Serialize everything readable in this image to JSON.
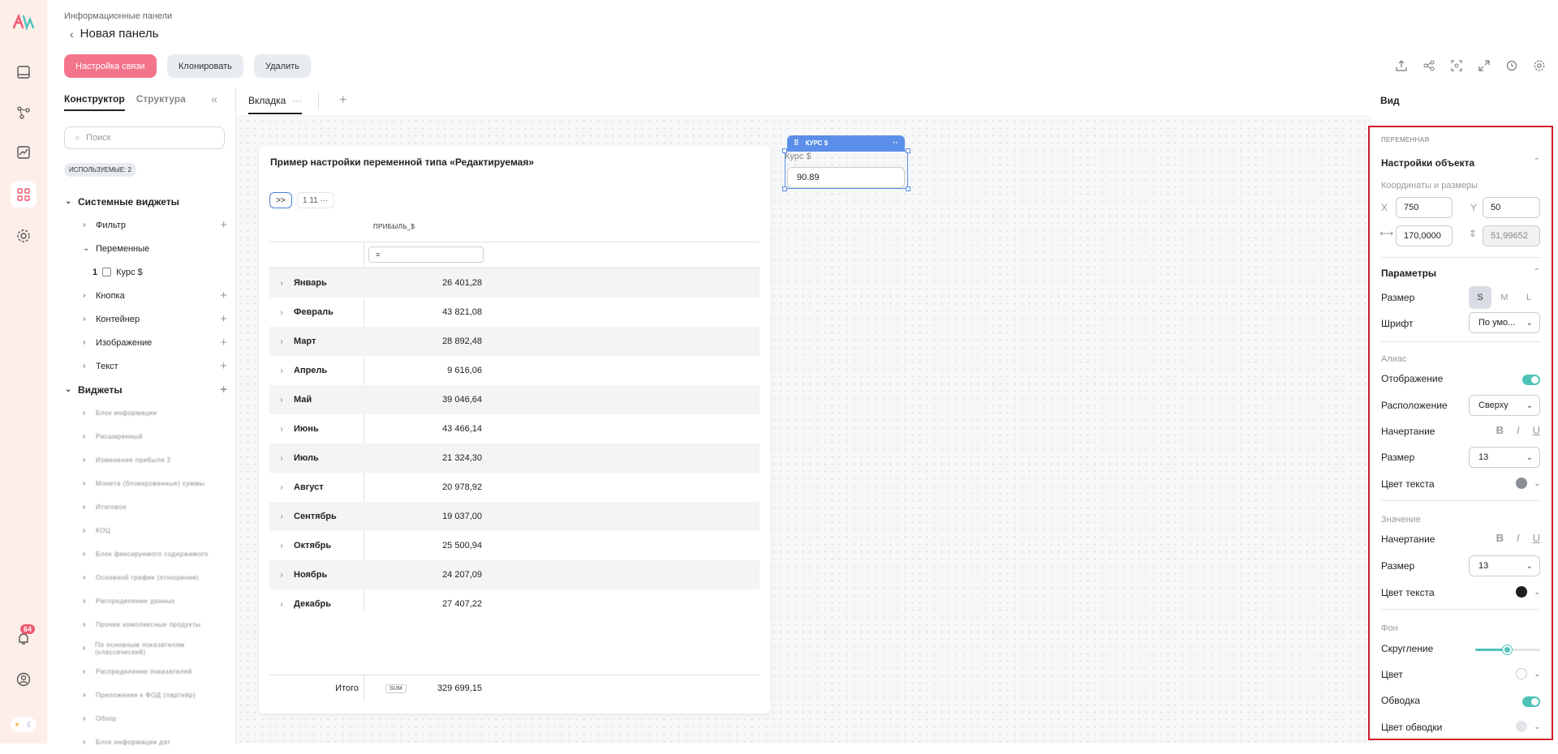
{
  "header": {
    "breadcrumb": "Информационные панели",
    "title": "Новая панель",
    "buttons": {
      "link_settings": "Настройка связи",
      "clone": "Клонировать",
      "delete": "Удалить"
    }
  },
  "sidebar": {
    "tab_constructor": "Конструктор",
    "tab_structure": "Структура",
    "search_placeholder": "Поиск",
    "used_badge": "ИСПОЛЬЗУЕМЫЕ: 2",
    "system_widgets_label": "Системные виджеты",
    "items": {
      "filter": "Фильтр",
      "variables": "Переменные",
      "variable_count": "1",
      "variable_name": "Курс $",
      "button": "Кнопка",
      "container": "Контейнер",
      "image": "Изображение",
      "text": "Текст"
    },
    "widgets_label": "Виджеты",
    "widget_items": [
      "Блок информации",
      "Расширенный",
      "Изменение прибыли 2",
      "Монета (блокированные) суммы",
      "Итоговое",
      "КОЦ",
      "Блок фиксируемого содержимого",
      "Основной график (отношение)",
      "Распределение данных",
      "Прочие комплексные продукты",
      "По основным показателям (классический)",
      "Распределение показателей",
      "Приложение к ФОД (партнёр)",
      "Обзор",
      "Блок информации дат"
    ]
  },
  "tabs": {
    "tab1": "Вкладка",
    "tab1_dots": "···",
    "add": "+"
  },
  "table_widget": {
    "title": "Пример настройки переменной типа «Редактируемая»",
    "expand_btn": ">>",
    "toolbar_b2": "1  11  ···",
    "column_header": "ПРИБЫЛЬ_$",
    "filter_icon": "≡",
    "rows": [
      {
        "month": "Январь",
        "value": "26 401,28"
      },
      {
        "month": "Февраль",
        "value": "43 821,08"
      },
      {
        "month": "Март",
        "value": "28 892,48"
      },
      {
        "month": "Апрель",
        "value": "9 616,06"
      },
      {
        "month": "Май",
        "value": "39 046,64"
      },
      {
        "month": "Июнь",
        "value": "43 466,14"
      },
      {
        "month": "Июль",
        "value": "21 324,30"
      },
      {
        "month": "Август",
        "value": "20 978,92"
      },
      {
        "month": "Сентябрь",
        "value": "19 037,00"
      },
      {
        "month": "Октябрь",
        "value": "25 500,94"
      },
      {
        "month": "Ноябрь",
        "value": "24 207,09"
      },
      {
        "month": "Декабрь",
        "value": "27 407,22"
      }
    ],
    "total_label": "Итого",
    "total_badge": "SUM",
    "total_value": "329 699,15"
  },
  "variable_widget": {
    "header": "КУРС $",
    "alias": "Курс $",
    "value": "90.89"
  },
  "right_panel": {
    "title": "Вид",
    "caption": "ПЕРЕМЕННАЯ",
    "object_settings": "Настройки объекта",
    "coords_label": "Координаты и размеры",
    "x_label": "X",
    "x_value": "750",
    "y_label": "Y",
    "y_value": "50",
    "width_value": "170,0000",
    "height_value": "51,99652",
    "params": "Параметры",
    "size_label": "Размер",
    "sizes": [
      "S",
      "M",
      "L"
    ],
    "font_label": "Шрифт",
    "font_value": "По умо...",
    "alias_section": "Алиас",
    "display_label": "Отображение",
    "position_label": "Расположение",
    "position_value": "Сверху",
    "style_label": "Начертание",
    "alias_size_label": "Размер",
    "alias_size_value": "13",
    "text_color_label": "Цвет текста",
    "alias_text_color": "#8a8f96",
    "value_section": "Значение",
    "value_style_label": "Начертание",
    "value_size_label": "Размер",
    "value_size_value": "13",
    "value_text_color_label": "Цвет текста",
    "value_text_color": "#1f1f1f",
    "bg_section": "Фон",
    "rounding_label": "Скругление",
    "rounding_level": 0.5,
    "color_label": "Цвет",
    "border_label": "Обводка",
    "border_color_label": "Цвет обводки",
    "fmt": {
      "b": "B",
      "i": "I",
      "u": "U"
    }
  },
  "notifications": {
    "count": "64"
  },
  "colors": {
    "accent": "#f3748b",
    "selection": "#5b8ee8",
    "toggle": "#4fc3b8",
    "highlight_border": "#d11a2a"
  }
}
